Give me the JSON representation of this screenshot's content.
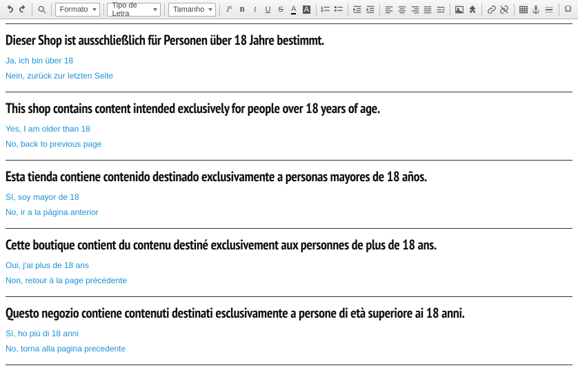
{
  "toolbar": {
    "format_label": "Formato",
    "font_label": "Tipo de Letra",
    "size_label": "Tamanho"
  },
  "sections": [
    {
      "heading": "Dieser Shop ist ausschließlich für Personen über 18 Jahre bestimmt.",
      "yes": "Ja, ich bin über 18",
      "no": "Nein, zurück zur letzten Seite"
    },
    {
      "heading": "This shop contains content intended exclusively for people over 18 years of age.",
      "yes": "Yes, I am older than 18",
      "no": "No, back to previous page"
    },
    {
      "heading": "Esta tienda contiene contenido destinado exclusivamente a personas mayores de 18 años.",
      "yes": "Sí, soy mayor de 18",
      "no": "No, ir a la página anterior"
    },
    {
      "heading": "Cette boutique contient du contenu destiné exclusivement aux personnes de plus de 18 ans.",
      "yes": "Oui, j'ai plus de 18 ans",
      "no": "Non, retour à la page précédente"
    },
    {
      "heading": "Questo negozio contiene contenuti destinati esclusivamente a persone di età superiore ai 18 anni.",
      "yes": "Sì, ho più di 18 anni",
      "no": "No, torna alla pagina precedente"
    }
  ]
}
